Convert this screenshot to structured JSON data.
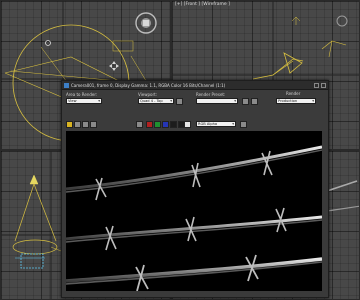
{
  "viewports": {
    "top_right_label": "[+] [Front ] [Wireframe ]"
  },
  "render_window": {
    "title": "Camera001, frame 0, Display Gamma: 1.1, RGBA Color 16 Bits/Channel (1:1)",
    "area_to_render_label": "Area to Render:",
    "area_to_render_value": "View",
    "viewport_label": "Viewport:",
    "viewport_value": "Quad 4 - Top",
    "render_preset_label": "Render Preset:",
    "render_preset_value": "",
    "render_button_label": "Render",
    "production_value": "Production",
    "channel_value": "RGB Alpha"
  }
}
